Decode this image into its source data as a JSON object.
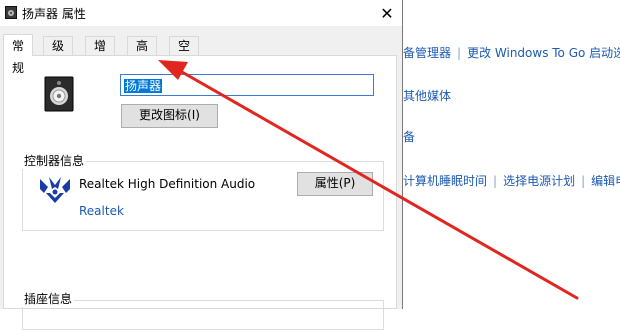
{
  "background": {
    "links": [
      {
        "items": [
          "备管理器",
          "更改 Windows To Go 启动选项"
        ]
      },
      {
        "items": [
          "其他媒体"
        ]
      },
      {
        "items": [
          "备"
        ]
      },
      {
        "items": [
          "计算机睡眠时间",
          "选择电源计划",
          "编辑电"
        ]
      }
    ]
  },
  "dialog": {
    "title": "扬声器 属性",
    "close": "✕",
    "tabs": [
      "常规",
      "级别",
      "增强",
      "高级",
      "空间音效"
    ],
    "active_tab": "常规",
    "name_value": "扬声器",
    "change_icon_button": "更改图标(I)",
    "controller_group_title": "控制器信息",
    "device_name": "Realtek High Definition Audio",
    "vendor": "Realtek",
    "properties_button": "属性(P)",
    "jack_group_title": "插座信息"
  },
  "colors": {
    "link": "#1c5ab4",
    "arrow": "#e0261e",
    "selection": "#0078d7"
  }
}
